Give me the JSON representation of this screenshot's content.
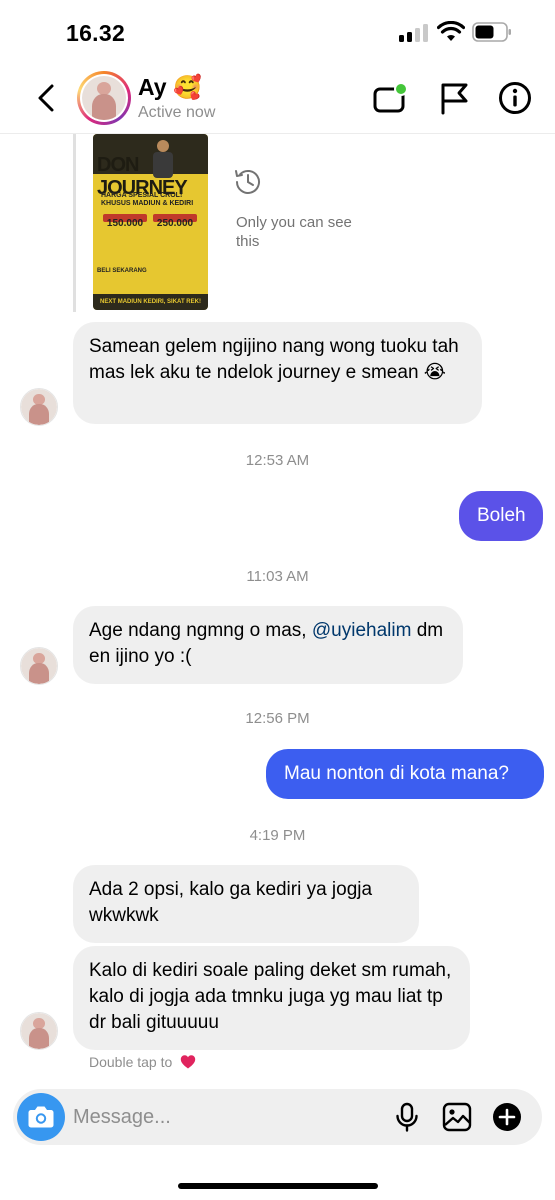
{
  "status_bar": {
    "time": "16.32"
  },
  "header": {
    "name": "Ay",
    "name_emoji": "🥰",
    "status": "Active now",
    "icons": [
      "back-icon",
      "video-call-icon",
      "flag-icon",
      "info-icon"
    ],
    "colors": {
      "online_dot": "#44c63a",
      "story_ring": [
        "#f58529",
        "#dd2a7b",
        "#8134af"
      ]
    }
  },
  "story_reply": {
    "preview_title": "DON JOURNEY",
    "preview_subtitle": "HARGA SPESIAL CROL! KHUSUS MADIUN & KEDIRI",
    "preview_prices": [
      "150.000",
      "250.000"
    ],
    "preview_cta": "BELI SEKARANG",
    "preview_footer": "NEXT MADIUN KEDIRI, SIKAT REK!",
    "notice_label": "Only you can see this"
  },
  "messages": [
    {
      "id": "m1",
      "from": "them",
      "text": "Samean gelem ngijino nang wong tuoku tah mas lek aku te ndelok journey e smean 😭"
    },
    {
      "id": "t1",
      "type": "timestamp",
      "text": "12:53 AM"
    },
    {
      "id": "m2",
      "from": "me",
      "text": "Boleh"
    },
    {
      "id": "t2",
      "type": "timestamp",
      "text": "11:03 AM"
    },
    {
      "id": "m3",
      "from": "them",
      "text_before": "Age ndang ngmng o mas, ",
      "mention": "@uyiehalim",
      "text_after": " dm en ijino yo :("
    },
    {
      "id": "t3",
      "type": "timestamp",
      "text": "12:56 PM"
    },
    {
      "id": "m4",
      "from": "me",
      "text": "Mau nonton di kota mana?"
    },
    {
      "id": "t4",
      "type": "timestamp",
      "text": "4:19 PM"
    },
    {
      "id": "m5",
      "from": "them",
      "text": "Ada 2 opsi, kalo ga kediri ya jogja wkwkwk"
    },
    {
      "id": "m6",
      "from": "them",
      "text": "Kalo di kediri soale paling deket sm rumah, kalo di jogja ada tmnku juga yg mau liat tp dr bali gituuuuu"
    }
  ],
  "double_tap_hint": "Double tap to",
  "composer": {
    "placeholder": "Message...",
    "icons": [
      "camera-icon",
      "microphone-icon",
      "gallery-icon",
      "plus-icon"
    ]
  },
  "colors": {
    "incoming_bubble": "#efefef",
    "outgoing_bubble_top": "#5b52e8",
    "outgoing_bubble_bottom": "#3c5ef0",
    "camera_button": "#3797f0",
    "mention": "#00376b"
  }
}
